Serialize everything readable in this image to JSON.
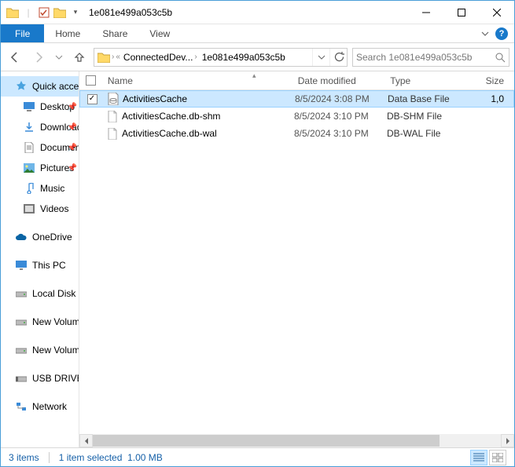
{
  "window": {
    "title": "1e081e499a053c5b"
  },
  "ribbon": {
    "file": "File",
    "tabs": [
      "Home",
      "Share",
      "View"
    ]
  },
  "breadcrumb": {
    "parts": [
      "ConnectedDev...",
      "1e081e499a053c5b"
    ]
  },
  "search": {
    "placeholder": "Search 1e081e499a053c5b"
  },
  "sidebar": {
    "quick_access": "Quick access",
    "items": [
      {
        "label": "Desktop",
        "pinned": true
      },
      {
        "label": "Downloads",
        "pinned": true
      },
      {
        "label": "Documents",
        "pinned": true
      },
      {
        "label": "Pictures",
        "pinned": true
      },
      {
        "label": "Music",
        "pinned": false
      },
      {
        "label": "Videos",
        "pinned": false
      }
    ],
    "onedrive": "OneDrive",
    "thispc": "This PC",
    "drives": [
      "Local Disk",
      "New Volume",
      "New Volume",
      "USB DRIVE"
    ],
    "network": "Network"
  },
  "columns": {
    "name": "Name",
    "date": "Date modified",
    "type": "Type",
    "size": "Size"
  },
  "files": [
    {
      "name": "ActivitiesCache",
      "date": "8/5/2024 3:08 PM",
      "type": "Data Base File",
      "size": "1,0",
      "selected": true,
      "icon": "db"
    },
    {
      "name": "ActivitiesCache.db-shm",
      "date": "8/5/2024 3:10 PM",
      "type": "DB-SHM File",
      "size": "",
      "selected": false,
      "icon": "file"
    },
    {
      "name": "ActivitiesCache.db-wal",
      "date": "8/5/2024 3:10 PM",
      "type": "DB-WAL File",
      "size": "",
      "selected": false,
      "icon": "file"
    }
  ],
  "status": {
    "count": "3 items",
    "selection": "1 item selected",
    "size": "1.00 MB"
  }
}
